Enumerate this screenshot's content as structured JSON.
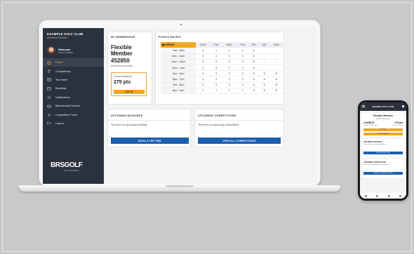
{
  "club": {
    "name": "EXAMPLE GOLF CLUB",
    "subtitle": "Members Website"
  },
  "user": {
    "greeting": "Welcome",
    "name": "David Bradley"
  },
  "sidebar": {
    "items": [
      {
        "label": "Home",
        "icon": "home-icon",
        "active": true
      },
      {
        "label": "Competitions",
        "icon": "trophy-icon"
      },
      {
        "label": "Tee Sheet",
        "icon": "teesheet-icon"
      },
      {
        "label": "Bookings",
        "icon": "calendar-icon"
      },
      {
        "label": "Notifications",
        "icon": "notification-icon"
      },
      {
        "label": "Membership Finance",
        "icon": "finance-icon"
      },
      {
        "label": "Competition Purse",
        "icon": "purse-icon"
      },
      {
        "label": "Logout",
        "icon": "logout-icon"
      }
    ]
  },
  "brand": {
    "logo_text": "BRSGOLF",
    "logo_sub": "BY GOLFNOW"
  },
  "membership": {
    "title": "MY MEMBERSHIP",
    "type_value": "Flexible Member",
    "type_label": "Membership Type",
    "number_value": "452850",
    "number_label": "Membership Number",
    "balance_label": "Current Balance",
    "balance_value": "275 pts",
    "topup_label": "TOP UP"
  },
  "points_matrix": {
    "title": "POINTS MATRIX",
    "period_header": "PERIOD",
    "days": [
      "MON",
      "TUE",
      "WED",
      "THU",
      "FRI",
      "SAT",
      "SUN"
    ],
    "rows": [
      {
        "period": "7am - 9am",
        "values": [
          "3",
          "1",
          "1",
          "1",
          "6",
          "-",
          "-"
        ]
      },
      {
        "period": "9am - 11am",
        "values": [
          "3",
          "3",
          "3",
          "3",
          "6",
          "-",
          "-"
        ]
      },
      {
        "period": "11am - 12pm",
        "values": [
          "4",
          "3",
          "3",
          "3",
          "6",
          "-",
          "-"
        ]
      },
      {
        "period": "12pm - 2pm",
        "values": [
          "4",
          "3",
          "3",
          "3",
          "6",
          "-",
          "-"
        ]
      },
      {
        "period": "2pm - 5pm",
        "values": [
          "4",
          "3",
          "3",
          "3",
          "6",
          "8",
          "8"
        ]
      },
      {
        "period": "5pm - 7pm",
        "values": [
          "3",
          "3",
          "3",
          "3",
          "6",
          "8",
          "8"
        ]
      },
      {
        "period": "7pm - 8pm",
        "values": [
          "3",
          "3",
          "3",
          "3",
          "6",
          "8",
          "8"
        ]
      },
      {
        "period": "8pm - 9pm",
        "values": [
          "1",
          "1",
          "1",
          "1",
          "6",
          "8",
          "8"
        ]
      }
    ]
  },
  "upcoming_bookings": {
    "title": "UPCOMING BOOKINGS",
    "empty_text": "You have no upcoming bookings",
    "button": "BOOK A TEE TIME"
  },
  "upcoming_competitions": {
    "title": "UPCOMING COMPETITIONS",
    "empty_text": "There are no upcoming competitions",
    "button": "VIEW ALL COMPETITIONS"
  },
  "phone": {
    "header": "EXAMPLE GOLF CLUB",
    "membership_type": "Flexible Member",
    "membership_type_label": "Membership Type",
    "number": "12345678",
    "points": "275 pts",
    "number_label": "Membership Number",
    "balance_label": "Current Balance",
    "option1": "TOP UP",
    "option2": "POINTS MATRIX",
    "bookings_title": "UPCOMING BOOKINGS",
    "bookings_text": "You have no upcoming bookings",
    "bookings_button": "BOOK A TEE TIME",
    "comps_title": "UPCOMING COMPETITIONS",
    "comps_text": "There are no upcoming competitions",
    "comps_button": "VIEW ALL COMPETITIONS"
  },
  "colors": {
    "sidebar": "#2b323d",
    "accent": "#f5a623",
    "primary": "#1b5fb0"
  }
}
